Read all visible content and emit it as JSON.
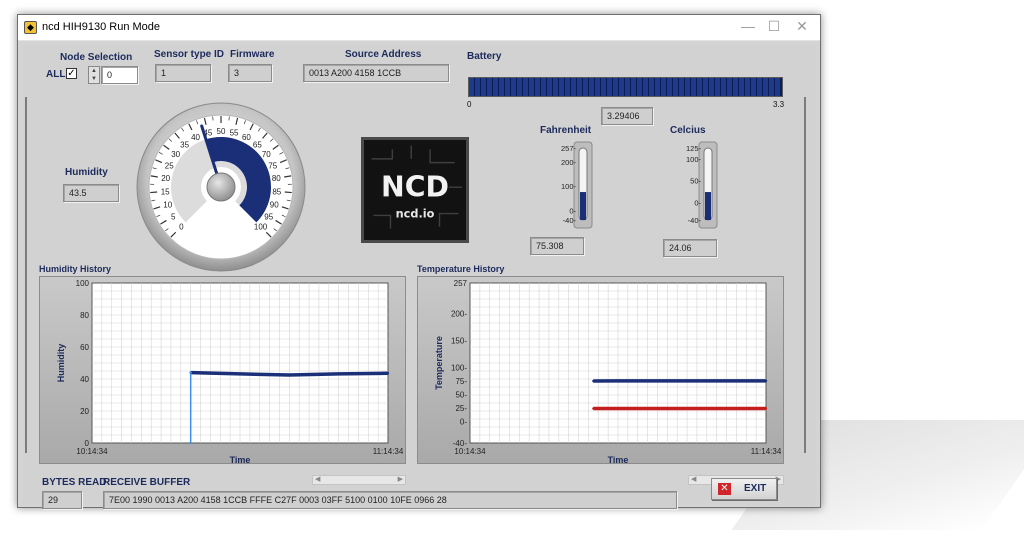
{
  "window": {
    "title": "ncd HIH9130 Run Mode",
    "min_glyph": "—",
    "max_glyph": "☐",
    "close_glyph": "✕"
  },
  "node_selection": {
    "label": "Node Selection",
    "all_label": "ALL",
    "all_checked": true,
    "value": "0"
  },
  "sensor_type": {
    "label": "Sensor type ID",
    "value": "1"
  },
  "firmware": {
    "label": "Firmware",
    "value": "3"
  },
  "source_address": {
    "label": "Source Address",
    "value": "0013 A200 4158 1CCB"
  },
  "battery": {
    "label": "Battery",
    "min_label": "0",
    "max_label": "3.3",
    "min": 0,
    "max": 3.3,
    "value": 3.29406,
    "value_text": "3.29406"
  },
  "humidity": {
    "label": "Humidity",
    "value": 43.5,
    "value_text": "43.5",
    "gauge_min": 0,
    "gauge_max": 100,
    "scale_labels": [
      "0",
      "5",
      "10",
      "15",
      "20",
      "25",
      "30",
      "35",
      "40",
      "45",
      "50",
      "55",
      "60",
      "65",
      "70",
      "75",
      "80",
      "85",
      "90",
      "95",
      "100"
    ]
  },
  "logo": {
    "brand_glyphs": "NCD",
    "site_text": "ncd.io"
  },
  "fahrenheit": {
    "label": "Fahrenheit",
    "value": 75.308,
    "value_text": "75.308",
    "scale_min": -40,
    "scale_max": 257,
    "scale_labels": [
      "257-",
      "200-",
      "100-",
      "0-",
      "-40-"
    ]
  },
  "celcius": {
    "label": "Celcius",
    "value": 24.06,
    "value_text": "24.06",
    "scale_min": -40,
    "scale_max": 125,
    "scale_labels": [
      "125-",
      "100-",
      "50-",
      "0-",
      "-40-"
    ]
  },
  "chart_data": [
    {
      "type": "line",
      "title": "Humidity History",
      "xlabel": "Time",
      "ylabel": "Humidity",
      "x_tick_labels": [
        "10:14:34",
        "11:14:34"
      ],
      "y_ticks": [
        0,
        20,
        40,
        60,
        80,
        100
      ],
      "ylim": [
        0,
        100
      ],
      "xlim": [
        0,
        60
      ],
      "grid": true,
      "series": [
        {
          "color": "#1a2f78",
          "x": [
            20,
            20.2,
            30,
            40,
            50,
            60
          ],
          "y": [
            44,
            44,
            43.2,
            42.5,
            43.2,
            43.6
          ]
        },
        {
          "color": "#3d8ee6",
          "x": [
            20,
            20
          ],
          "y": [
            0,
            44
          ]
        }
      ]
    },
    {
      "type": "line",
      "title": "Temperature History",
      "xlabel": "Time",
      "ylabel": "Temperature",
      "x_tick_labels": [
        "10:14:34",
        "11:14:34"
      ],
      "y_ticks": [
        -40,
        0,
        25,
        50,
        75,
        100,
        150,
        200,
        257
      ],
      "y_tick_labels": [
        "-40-",
        "0-",
        "25-",
        "50-",
        "75-",
        "100-",
        "150-",
        "200-",
        "257"
      ],
      "ylim": [
        -40,
        257
      ],
      "xlim": [
        0,
        60
      ],
      "grid": true,
      "series": [
        {
          "color": "#1a2f78",
          "x": [
            25,
            30,
            40,
            50,
            60
          ],
          "y": [
            75,
            75.3,
            75.3,
            75.3,
            75.3
          ]
        },
        {
          "color": "#c41e1e",
          "x": [
            25,
            30,
            40,
            50,
            60
          ],
          "y": [
            24,
            24,
            24,
            24.1,
            24.1
          ]
        }
      ]
    }
  ],
  "bytes_read": {
    "label": "BYTES READ",
    "value": "29"
  },
  "receive_buffer": {
    "label": "RECEIVE BUFFER",
    "value": "7E00 1990 0013 A200 4158 1CCB FFFE C27F 0003 03FF 5100 0100 10FE 0966 28"
  },
  "scroll": {
    "left_glyph": "◀",
    "right_glyph": "▶"
  },
  "exit_button": {
    "label": "EXIT",
    "icon_glyph": "✕"
  }
}
